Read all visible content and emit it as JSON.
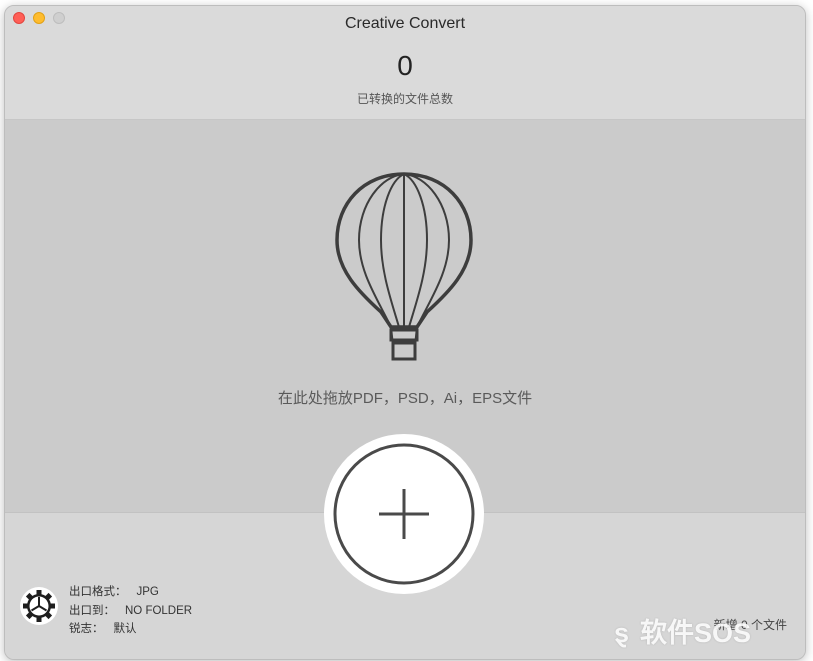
{
  "window": {
    "title": "Creative Convert",
    "buttons": {
      "close": "close",
      "minimize": "minimize",
      "zoom": "zoom"
    }
  },
  "stats": {
    "converted_count": "0",
    "converted_label": "已转换的文件总数"
  },
  "dropzone": {
    "icon": "hot-air-balloon-icon",
    "hint": "在此处拖放PDF，PSD，Ai，EPS文件"
  },
  "add_button": {
    "icon": "plus-icon"
  },
  "settings": {
    "icon": "gear-icon",
    "format_label": "出口格式：",
    "format_value": "JPG",
    "output_label": "出口到：",
    "output_value": "NO FOLDER",
    "sharpen_label": "锐志：",
    "sharpen_value": "默认"
  },
  "status": {
    "added_text": "新增 0 个文件"
  },
  "watermark": {
    "text": "软件SOS"
  },
  "colors": {
    "close": "#ff5f57",
    "minimize": "#febc2e",
    "zoom": "#cfcfcf",
    "window_bg": "#d6d6d6",
    "dropzone_bg": "#cbcbcb"
  }
}
